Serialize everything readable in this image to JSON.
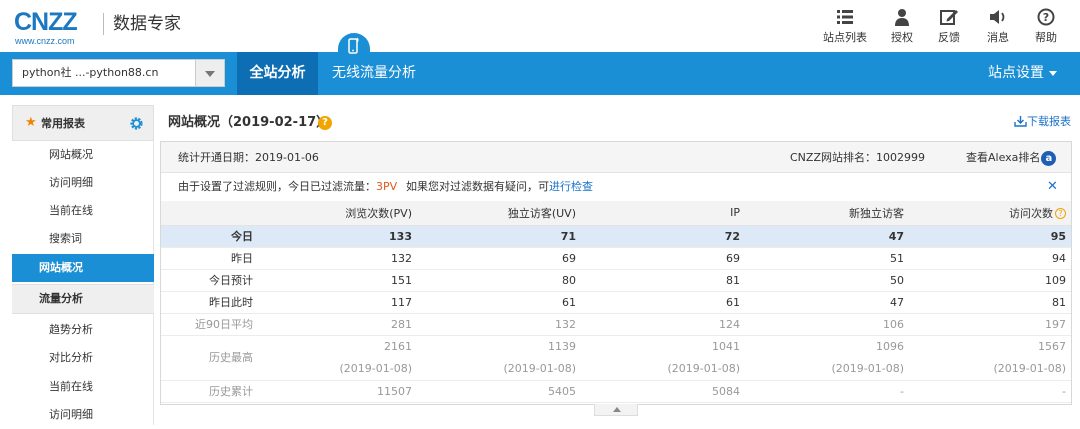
{
  "brand": {
    "logo_big": "CNZZ",
    "logo_url": "www.cnzz.com",
    "product": "数据专家"
  },
  "toolbar": [
    {
      "label": "站点列表",
      "icon": "list-icon"
    },
    {
      "label": "授权",
      "icon": "user-icon"
    },
    {
      "label": "反馈",
      "icon": "edit-icon"
    },
    {
      "label": "消息",
      "icon": "speaker-icon"
    },
    {
      "label": "帮助",
      "icon": "help-icon"
    }
  ],
  "nav": {
    "site_select": "python社 ...-python88.cn",
    "tab_all": "全站分析",
    "tab_mobile": "无线流量分析",
    "settings": "站点设置"
  },
  "sidebar": {
    "header": "常用报表",
    "items": [
      {
        "label": "网站概况",
        "type": "sub"
      },
      {
        "label": "访问明细",
        "type": "sub"
      },
      {
        "label": "当前在线",
        "type": "sub"
      },
      {
        "label": "搜索词",
        "type": "sub"
      },
      {
        "label": "网站概况",
        "type": "active"
      },
      {
        "label": "流量分析",
        "type": "section"
      },
      {
        "label": "趋势分析",
        "type": "sub"
      },
      {
        "label": "对比分析",
        "type": "sub"
      },
      {
        "label": "当前在线",
        "type": "sub"
      },
      {
        "label": "访问明细",
        "type": "sub"
      }
    ]
  },
  "main": {
    "title": "网站概况（2019-02-17）",
    "download": "下载报表",
    "open_date": "统计开通日期：2019-01-06",
    "rank": "CNZZ网站排名：1002999",
    "alexa": "查看Alexa排名",
    "filter": {
      "prefix": "由于设置了过滤规则，今日已过滤流量：",
      "pv": "3PV",
      "question": "如果您对过滤数据有疑问，可",
      "link": "进行检查"
    },
    "table": {
      "headers": [
        "",
        "浏览次数(PV)",
        "独立访客(UV)",
        "IP",
        "新独立访客",
        "访问次数"
      ],
      "rows": [
        {
          "label": "今日",
          "values": [
            "133",
            "71",
            "72",
            "47",
            "95"
          ],
          "style": "today"
        },
        {
          "label": "昨日",
          "values": [
            "132",
            "69",
            "69",
            "51",
            "94"
          ],
          "style": ""
        },
        {
          "label": "今日预计",
          "values": [
            "151",
            "80",
            "81",
            "50",
            "109"
          ],
          "style": ""
        },
        {
          "label": "昨日此时",
          "values": [
            "117",
            "61",
            "61",
            "47",
            "81"
          ],
          "style": ""
        },
        {
          "label": "近90日平均",
          "values": [
            "281",
            "132",
            "124",
            "106",
            "197"
          ],
          "style": "muted"
        },
        {
          "label": "历史最高",
          "values": [
            "2161",
            "1139",
            "1041",
            "1096",
            "1567"
          ],
          "dates": [
            "(2019-01-08)",
            "(2019-01-08)",
            "(2019-01-08)",
            "(2019-01-08)",
            "(2019-01-08)"
          ],
          "style": "muted tall"
        },
        {
          "label": "历史累计",
          "values": [
            "11507",
            "5405",
            "5084",
            "-",
            "-"
          ],
          "style": "muted"
        }
      ]
    }
  }
}
